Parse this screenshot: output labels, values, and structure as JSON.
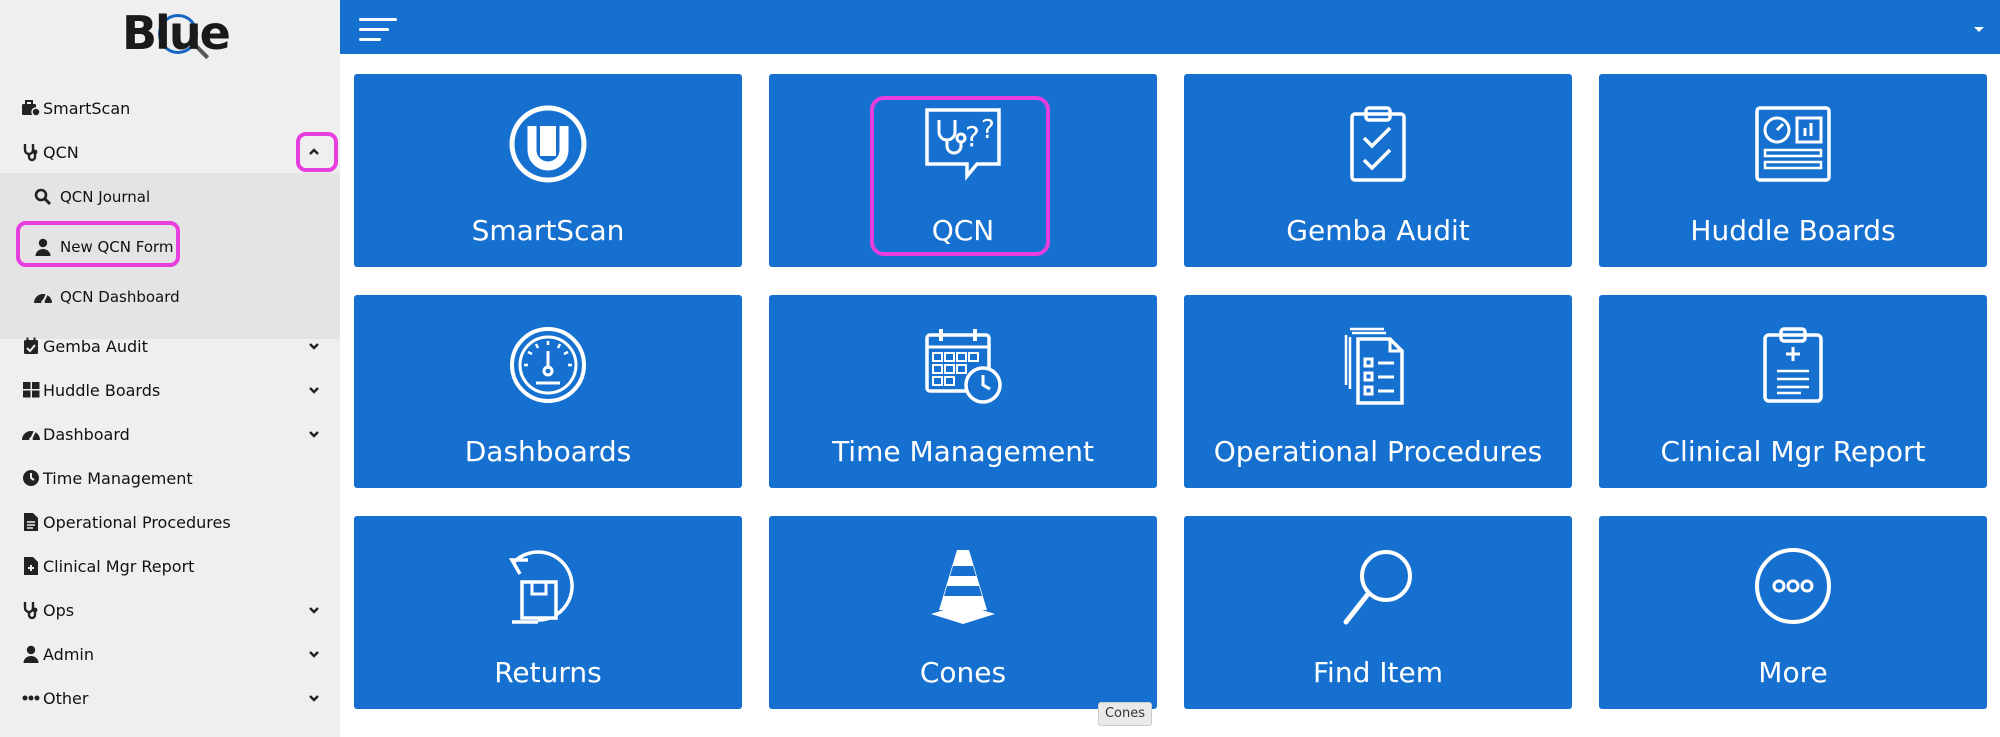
{
  "app": {
    "logo_text": "Blue"
  },
  "sidebar": {
    "items": [
      {
        "label": "SmartScan",
        "icon": "briefcase-icon"
      },
      {
        "label": "QCN",
        "icon": "stethoscope-icon",
        "expanded": true
      },
      {
        "label": "Gemba Audit",
        "icon": "calendar-check-icon"
      },
      {
        "label": "Huddle Boards",
        "icon": "grid-icon"
      },
      {
        "label": "Dashboard",
        "icon": "gauge-icon"
      },
      {
        "label": "Time Management",
        "icon": "clock-icon"
      },
      {
        "label": "Operational Procedures",
        "icon": "file-icon"
      },
      {
        "label": "Clinical Mgr Report",
        "icon": "file-medical-icon"
      },
      {
        "label": "Ops",
        "icon": "stethoscope-icon"
      },
      {
        "label": "Admin",
        "icon": "user-icon"
      },
      {
        "label": "Other",
        "icon": "ellipsis-icon"
      }
    ],
    "qcn_subitems": [
      {
        "label": "QCN Journal",
        "icon": "search-icon"
      },
      {
        "label": "New QCN Form",
        "icon": "user-icon"
      },
      {
        "label": "QCN Dashboard",
        "icon": "gauge-icon"
      }
    ]
  },
  "tiles": [
    {
      "label": "SmartScan",
      "icon": "smartscan-logo-icon"
    },
    {
      "label": "QCN",
      "icon": "stethoscope-question-icon"
    },
    {
      "label": "Gemba Audit",
      "icon": "clipboard-check-icon"
    },
    {
      "label": "Huddle Boards",
      "icon": "board-icon"
    },
    {
      "label": "Dashboards",
      "icon": "gauge-icon"
    },
    {
      "label": "Time Management",
      "icon": "calendar-clock-icon"
    },
    {
      "label": "Operational Procedures",
      "icon": "documents-icon"
    },
    {
      "label": "Clinical Mgr Report",
      "icon": "medical-clipboard-icon"
    },
    {
      "label": "Returns",
      "icon": "return-box-icon"
    },
    {
      "label": "Cones",
      "icon": "traffic-cone-icon"
    },
    {
      "label": "Find Item",
      "icon": "magnifier-icon"
    },
    {
      "label": "More",
      "icon": "more-circle-icon"
    }
  ],
  "tooltip": {
    "text": "Cones"
  },
  "colors": {
    "primary": "#1670d0",
    "highlight": "#e83ee0",
    "sidebar_bg": "#efefef"
  }
}
